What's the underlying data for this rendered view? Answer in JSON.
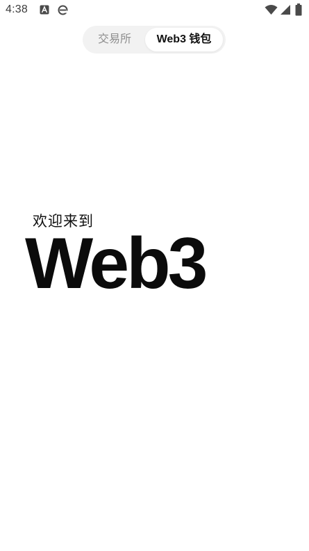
{
  "status_bar": {
    "time": "4:38",
    "icons": [
      "app-notification-a-icon",
      "browser-e-icon",
      "wifi-icon",
      "signal-icon",
      "battery-icon"
    ]
  },
  "segmented": {
    "tabs": [
      {
        "label": "交易所",
        "selected": false
      },
      {
        "label": "Web3 钱包",
        "selected": true
      }
    ]
  },
  "welcome": {
    "subtitle": "欢迎来到",
    "title": "Web3"
  },
  "colors": {
    "background": "#ffffff",
    "text_primary": "#111111",
    "text_muted": "#8e8e8e",
    "segment_bg": "#f2f2f2",
    "segment_active_bg": "#ffffff"
  }
}
